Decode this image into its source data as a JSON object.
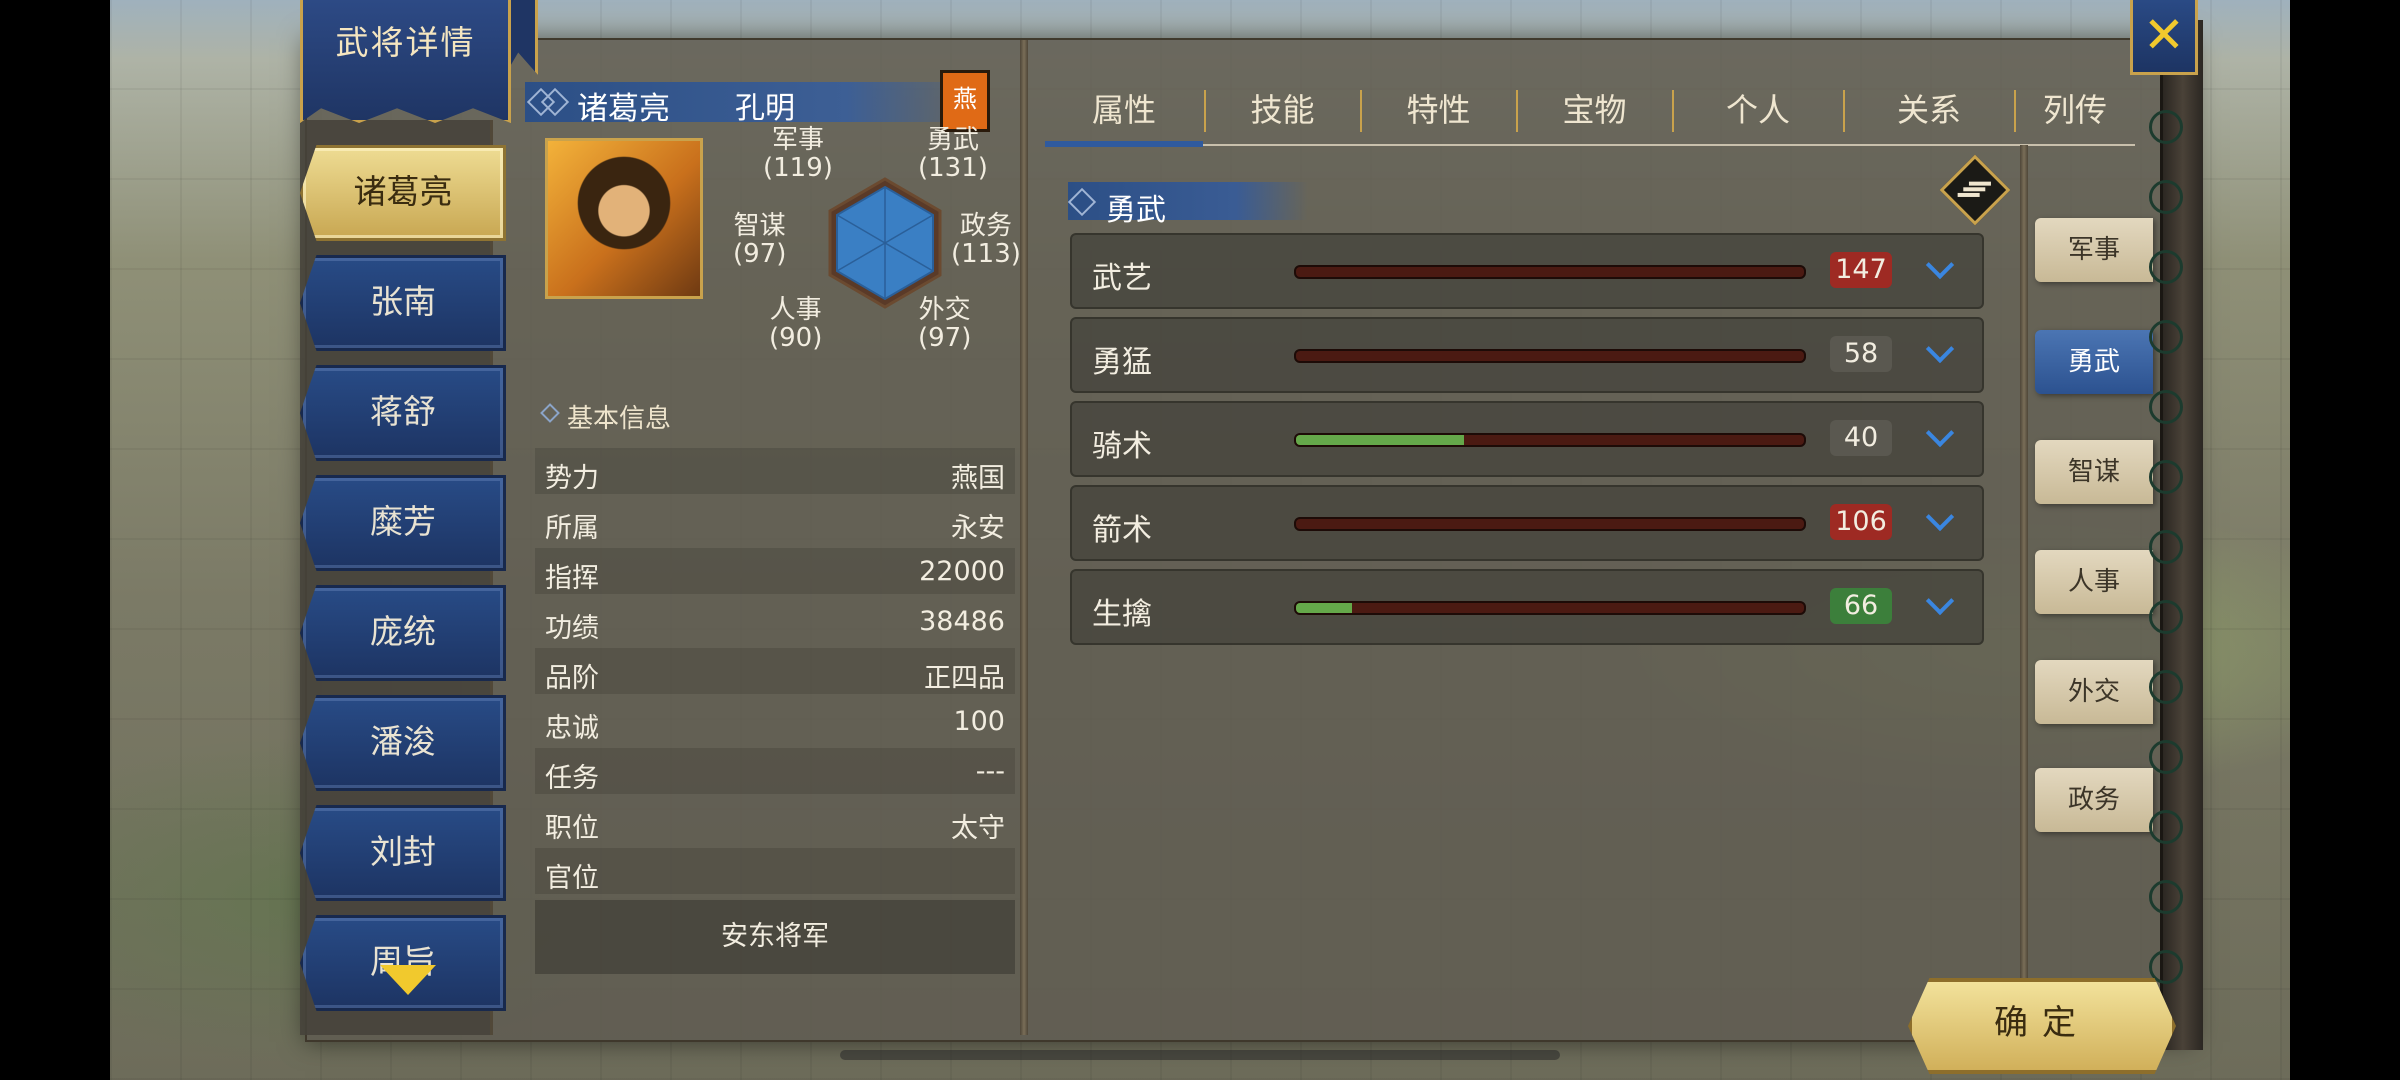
{
  "window": {
    "title": "武将详情",
    "close_glyph": "✕"
  },
  "officers": [
    {
      "name": "诸葛亮",
      "active": true
    },
    {
      "name": "张南"
    },
    {
      "name": "蒋舒"
    },
    {
      "name": "糜芳"
    },
    {
      "name": "庞统"
    },
    {
      "name": "潘浚"
    },
    {
      "name": "刘封"
    },
    {
      "name": "周旨"
    }
  ],
  "profile": {
    "name": "诸葛亮",
    "style_name": "孔明",
    "faction_glyph": "燕",
    "radar": {
      "military": {
        "label": "军事",
        "value": "(119)"
      },
      "valor": {
        "label": "勇武",
        "value": "(131)"
      },
      "intelligence": {
        "label": "智谋",
        "value": "(97)"
      },
      "politics": {
        "label": "政务",
        "value": "(113)"
      },
      "personnel": {
        "label": "人事",
        "value": "(90)"
      },
      "diplomacy": {
        "label": "外交",
        "value": "(97)"
      }
    },
    "basic_info": {
      "header": "基本信息",
      "rows": [
        {
          "key": "势力",
          "value": "燕国"
        },
        {
          "key": "所属",
          "value": "永安"
        },
        {
          "key": "指挥",
          "value": "22000"
        },
        {
          "key": "功绩",
          "value": "38486"
        },
        {
          "key": "品阶",
          "value": "正四品"
        },
        {
          "key": "忠诚",
          "value": "100"
        },
        {
          "key": "任务",
          "value": "---"
        },
        {
          "key": "职位",
          "value": "太守"
        },
        {
          "key": "官位",
          "value": ""
        }
      ],
      "office_title": "安东将军"
    }
  },
  "tabs": [
    "属性",
    "技能",
    "特性",
    "宝物",
    "个人",
    "关系",
    "列传"
  ],
  "active_tab": "属性",
  "section_title": "勇武",
  "stats": [
    {
      "label": "武艺",
      "value": "147",
      "fill": 0.0,
      "badge": "red"
    },
    {
      "label": "勇猛",
      "value": "58",
      "fill": 0.0,
      "badge": "neutral"
    },
    {
      "label": "骑术",
      "value": "40",
      "fill": 0.33,
      "badge": "neutral"
    },
    {
      "label": "箭术",
      "value": "106",
      "fill": 0.0,
      "badge": "red"
    },
    {
      "label": "生擒",
      "value": "66",
      "fill": 0.11,
      "badge": "green"
    }
  ],
  "side_tabs": [
    "军事",
    "勇武",
    "智谋",
    "人事",
    "外交",
    "政务"
  ],
  "active_side_tab": "勇武",
  "confirm_label": "确定",
  "colors": {
    "accent_blue": "#2c4f86",
    "gold": "#c9a24c",
    "value_red": "#9e2a23",
    "value_green": "#3c7f3b",
    "fill_green": "#65a84a"
  },
  "icons": {
    "close": "close-icon",
    "list": "list-icon",
    "expand": "chevron-down-icon",
    "scroll": "scroll-down-icon"
  }
}
